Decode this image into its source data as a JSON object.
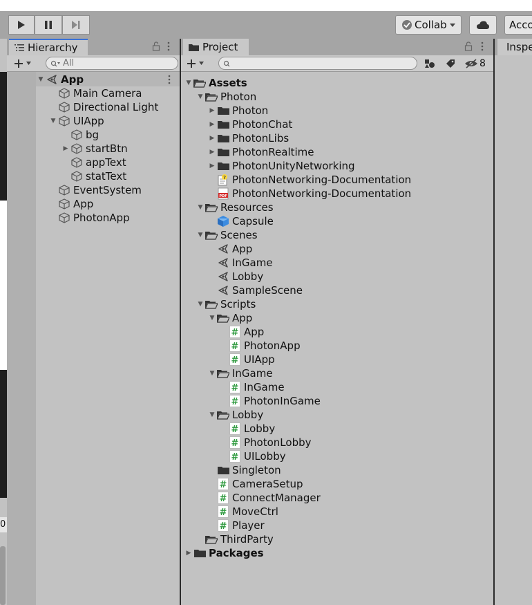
{
  "toolbar": {
    "collab_label": "Collab",
    "account_label": "Account"
  },
  "hierarchy": {
    "tab_label": "Hierarchy",
    "search_placeholder": "All",
    "items": [
      {
        "label": "App",
        "depth": 0,
        "arrow": "down",
        "icon": "scene",
        "bold": true
      },
      {
        "label": "Main Camera",
        "depth": 1,
        "arrow": "none",
        "icon": "cube"
      },
      {
        "label": "Directional Light",
        "depth": 1,
        "arrow": "none",
        "icon": "cube"
      },
      {
        "label": "UIApp",
        "depth": 1,
        "arrow": "down",
        "icon": "cube"
      },
      {
        "label": "bg",
        "depth": 2,
        "arrow": "none",
        "icon": "cube"
      },
      {
        "label": "startBtn",
        "depth": 2,
        "arrow": "right",
        "icon": "cube"
      },
      {
        "label": "appText",
        "depth": 2,
        "arrow": "none",
        "icon": "cube"
      },
      {
        "label": "statText",
        "depth": 2,
        "arrow": "none",
        "icon": "cube"
      },
      {
        "label": "EventSystem",
        "depth": 1,
        "arrow": "none",
        "icon": "cube"
      },
      {
        "label": "App",
        "depth": 1,
        "arrow": "none",
        "icon": "cube"
      },
      {
        "label": "PhotonApp",
        "depth": 1,
        "arrow": "none",
        "icon": "cube"
      }
    ]
  },
  "project": {
    "tab_label": "Project",
    "hidden_count": "8",
    "items": [
      {
        "label": "Assets",
        "depth": 0,
        "arrow": "down",
        "icon": "folder-open",
        "bold": true
      },
      {
        "label": "Photon",
        "depth": 1,
        "arrow": "down",
        "icon": "folder-open"
      },
      {
        "label": "Photon",
        "depth": 2,
        "arrow": "right",
        "icon": "folder"
      },
      {
        "label": "PhotonChat",
        "depth": 2,
        "arrow": "right",
        "icon": "folder"
      },
      {
        "label": "PhotonLibs",
        "depth": 2,
        "arrow": "right",
        "icon": "folder"
      },
      {
        "label": "PhotonRealtime",
        "depth": 2,
        "arrow": "right",
        "icon": "folder"
      },
      {
        "label": "PhotonUnityNetworking",
        "depth": 2,
        "arrow": "right",
        "icon": "folder"
      },
      {
        "label": "PhotonNetworking-Documentation",
        "depth": 2,
        "arrow": "none",
        "icon": "doc"
      },
      {
        "label": "PhotonNetworking-Documentation",
        "depth": 2,
        "arrow": "none",
        "icon": "pdf"
      },
      {
        "label": "Resources",
        "depth": 1,
        "arrow": "down",
        "icon": "folder-open"
      },
      {
        "label": "Capsule",
        "depth": 2,
        "arrow": "none",
        "icon": "prefab"
      },
      {
        "label": "Scenes",
        "depth": 1,
        "arrow": "down",
        "icon": "folder-open"
      },
      {
        "label": "App",
        "depth": 2,
        "arrow": "none",
        "icon": "scene"
      },
      {
        "label": "InGame",
        "depth": 2,
        "arrow": "none",
        "icon": "scene"
      },
      {
        "label": "Lobby",
        "depth": 2,
        "arrow": "none",
        "icon": "scene"
      },
      {
        "label": "SampleScene",
        "depth": 2,
        "arrow": "none",
        "icon": "scene"
      },
      {
        "label": "Scripts",
        "depth": 1,
        "arrow": "down",
        "icon": "folder-open"
      },
      {
        "label": "App",
        "depth": 2,
        "arrow": "down",
        "icon": "folder-open"
      },
      {
        "label": "App",
        "depth": 3,
        "arrow": "none",
        "icon": "script"
      },
      {
        "label": "PhotonApp",
        "depth": 3,
        "arrow": "none",
        "icon": "script"
      },
      {
        "label": "UIApp",
        "depth": 3,
        "arrow": "none",
        "icon": "script"
      },
      {
        "label": "InGame",
        "depth": 2,
        "arrow": "down",
        "icon": "folder-open"
      },
      {
        "label": "InGame",
        "depth": 3,
        "arrow": "none",
        "icon": "script"
      },
      {
        "label": "PhotonInGame",
        "depth": 3,
        "arrow": "none",
        "icon": "script"
      },
      {
        "label": "Lobby",
        "depth": 2,
        "arrow": "down",
        "icon": "folder-open"
      },
      {
        "label": "Lobby",
        "depth": 3,
        "arrow": "none",
        "icon": "script"
      },
      {
        "label": "PhotonLobby",
        "depth": 3,
        "arrow": "none",
        "icon": "script"
      },
      {
        "label": "UILobby",
        "depth": 3,
        "arrow": "none",
        "icon": "script"
      },
      {
        "label": "Singleton",
        "depth": 2,
        "arrow": "none",
        "icon": "folder"
      },
      {
        "label": "CameraSetup",
        "depth": 2,
        "arrow": "none",
        "icon": "script"
      },
      {
        "label": "ConnectManager",
        "depth": 2,
        "arrow": "none",
        "icon": "script"
      },
      {
        "label": "MoveCtrl",
        "depth": 2,
        "arrow": "none",
        "icon": "script"
      },
      {
        "label": "Player",
        "depth": 2,
        "arrow": "none",
        "icon": "script"
      },
      {
        "label": "ThirdParty",
        "depth": 1,
        "arrow": "none",
        "icon": "folder-open"
      },
      {
        "label": "Packages",
        "depth": 0,
        "arrow": "right",
        "icon": "folder",
        "bold": true
      }
    ]
  },
  "inspector": {
    "tab_label": "Inspector"
  },
  "left_edge": {
    "bottom_value": "0"
  }
}
